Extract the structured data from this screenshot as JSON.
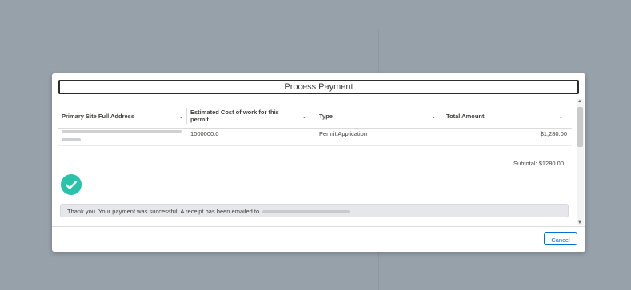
{
  "modal": {
    "title": "Process Payment",
    "columns": [
      {
        "label": "Primary Site Full Address"
      },
      {
        "label": "Estimated Cost of work for this permit"
      },
      {
        "label": "Type"
      },
      {
        "label": "Total Amount"
      }
    ],
    "rows": [
      {
        "address": "",
        "estimated_cost": "1000000.0",
        "type": "Permit Application",
        "total": "$1,280.00"
      }
    ],
    "subtotal": "Subtotal: $1280.00",
    "success_message": "Thank you. Your payment was successful. A receipt has been emailed to",
    "cancel_label": "Cancel"
  },
  "icons": {
    "column_sort": "chevron-down-icon",
    "success": "checkmark-circle-icon"
  },
  "colors": {
    "overlay": "#97a1aa",
    "success_green": "#28c3a8",
    "brand_blue": "#0070d2"
  }
}
